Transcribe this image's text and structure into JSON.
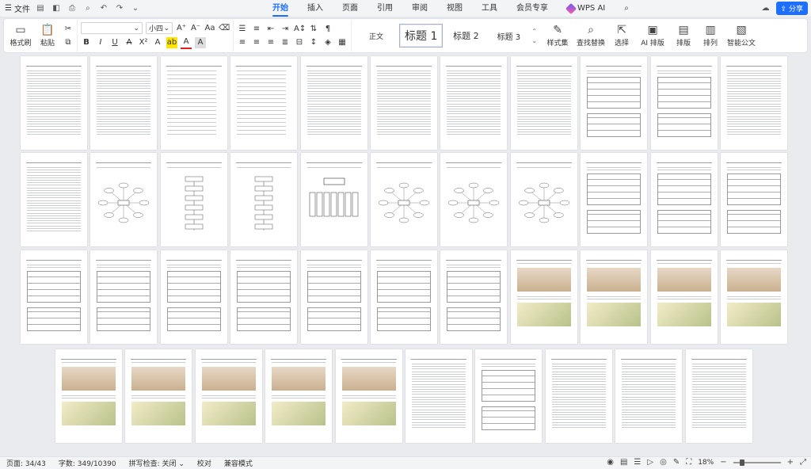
{
  "menubar": {
    "file_label": "文件",
    "tabs": [
      {
        "label": "开始",
        "active": true
      },
      {
        "label": "插入"
      },
      {
        "label": "页面"
      },
      {
        "label": "引用"
      },
      {
        "label": "审阅"
      },
      {
        "label": "视图"
      },
      {
        "label": "工具"
      },
      {
        "label": "会员专享"
      }
    ],
    "wps_ai_label": "WPS AI",
    "share_label": "分享"
  },
  "ribbon": {
    "format_painter": "格式刷",
    "paste": "粘贴",
    "font_name": "",
    "font_size": "小四",
    "styles": {
      "normal": "正文",
      "h1": "标题 1",
      "h2": "标题 2",
      "h3": "标题 3"
    },
    "style_set": "样式集",
    "find_replace": "查找替换",
    "select": "选择",
    "ai_layout": "AI 排版",
    "layout": "排版",
    "arrange": "排列",
    "smart_doc": "智能公文"
  },
  "status": {
    "page": "页面: 34/43",
    "words": "字数: 349/10390",
    "spell": "拼写检查: 关闭",
    "proof": "校对",
    "compat": "兼容模式",
    "zoom": "18%"
  },
  "colors": {
    "accent": "#1e6fff"
  }
}
